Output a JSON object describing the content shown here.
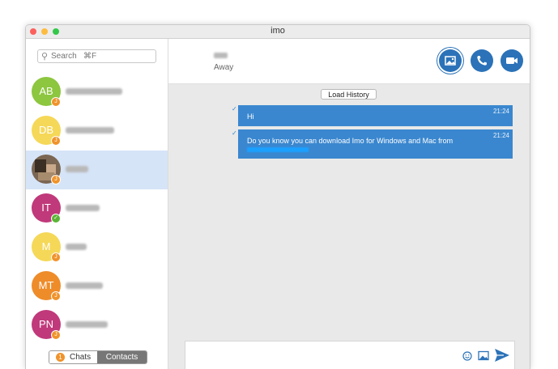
{
  "window": {
    "title": "imo"
  },
  "search": {
    "placeholder": "Search   ⌘F"
  },
  "contacts": [
    {
      "initials": "AB",
      "color": "#8dc63f",
      "status": "away"
    },
    {
      "initials": "DB",
      "color": "#f5d858",
      "status": "away"
    },
    {
      "initials": "",
      "color": "#7a6652",
      "status": "away",
      "selected": true,
      "photo": true
    },
    {
      "initials": "IT",
      "color": "#c0397a",
      "status": "online"
    },
    {
      "initials": "M",
      "color": "#f5d858",
      "status": "away"
    },
    {
      "initials": "MT",
      "color": "#ee8c2a",
      "status": "away"
    },
    {
      "initials": "PN",
      "color": "#c0397a",
      "status": "away"
    }
  ],
  "badges": {
    "away": "J",
    "online": "✓"
  },
  "tabs": {
    "chats_label": "Chats",
    "chats_count": "1",
    "contacts_label": "Contacts"
  },
  "chat_header": {
    "peer_status": "Away"
  },
  "history_button": "Load History",
  "messages": [
    {
      "text": "Hi",
      "time": "21:24",
      "tick": "✓"
    },
    {
      "text": "Do you know you can download Imo for Windows and Mac from",
      "time": "21:24",
      "tick": "✓"
    }
  ],
  "colors": {
    "accent": "#2b72b8",
    "bubble": "#3a87cf",
    "badge_orange": "#f0932b",
    "badge_green": "#5bb535"
  },
  "icons": {
    "emoji": "smiley-icon",
    "attach": "image-icon",
    "send": "send-icon"
  }
}
